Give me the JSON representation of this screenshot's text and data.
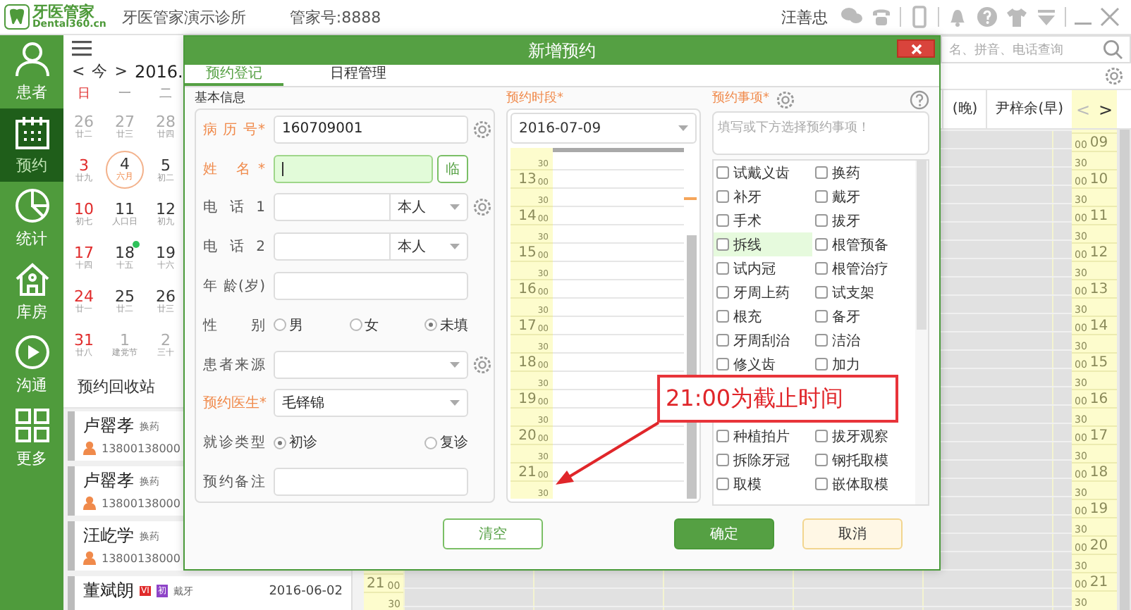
{
  "header": {
    "logo_title": "牙医管家",
    "logo_subtitle": "Dental360.cn",
    "clinic": "牙医管家演示诊所",
    "account": "管家号:8888",
    "user": "汪善忠"
  },
  "sidebar": {
    "items": [
      {
        "label": "患者",
        "selected": false
      },
      {
        "label": "预约",
        "selected": true
      },
      {
        "label": "统计",
        "selected": false
      },
      {
        "label": "库房",
        "selected": false
      },
      {
        "label": "沟通",
        "selected": false
      },
      {
        "label": "更多",
        "selected": false
      }
    ]
  },
  "calendar_panel": {
    "nav": {
      "prev": "<",
      "today": "今",
      "next": ">",
      "month": "2016."
    },
    "weekdays": [
      "日",
      "一",
      "二"
    ],
    "weeks": [
      [
        {
          "day": "26",
          "lunar": "廿二",
          "muted": true,
          "today": false,
          "has_event": false
        },
        {
          "day": "27",
          "lunar": "廿三",
          "muted": true,
          "today": false,
          "has_event": false
        },
        {
          "day": "28",
          "lunar": "廿四",
          "muted": true,
          "today": false,
          "has_event": false
        }
      ],
      [
        {
          "day": "3",
          "lunar": "廿九",
          "muted": false,
          "today": false,
          "has_event": false
        },
        {
          "day": "4",
          "lunar": "六月",
          "muted": false,
          "today": true,
          "has_event": false
        },
        {
          "day": "5",
          "lunar": "初二",
          "muted": false,
          "today": false,
          "has_event": false
        }
      ],
      [
        {
          "day": "10",
          "lunar": "初七",
          "muted": false,
          "today": false,
          "has_event": false
        },
        {
          "day": "11",
          "lunar": "人口日",
          "muted": false,
          "today": false,
          "has_event": false
        },
        {
          "day": "12",
          "lunar": "初九",
          "muted": false,
          "today": false,
          "has_event": false
        }
      ],
      [
        {
          "day": "17",
          "lunar": "十四",
          "muted": false,
          "today": false,
          "has_event": false
        },
        {
          "day": "18",
          "lunar": "十五",
          "muted": false,
          "today": false,
          "has_event": true
        },
        {
          "day": "19",
          "lunar": "十六",
          "muted": false,
          "today": false,
          "has_event": false
        }
      ],
      [
        {
          "day": "24",
          "lunar": "廿一",
          "muted": false,
          "today": false,
          "has_event": false
        },
        {
          "day": "25",
          "lunar": "廿二",
          "muted": false,
          "today": false,
          "has_event": false
        },
        {
          "day": "26",
          "lunar": "廿三",
          "muted": false,
          "today": false,
          "has_event": false
        }
      ],
      [
        {
          "day": "31",
          "lunar": "廿八",
          "muted": false,
          "today": false,
          "has_event": false
        },
        {
          "day": "1",
          "lunar": "建党节",
          "muted": true,
          "today": false,
          "has_event": false
        },
        {
          "day": "2",
          "lunar": "三十",
          "muted": true,
          "today": false,
          "has_event": false
        }
      ]
    ],
    "recycle_title": "预约回收站",
    "appointments": [
      {
        "name": "卢罂孝",
        "tag": "换药",
        "phone": "13800138000"
      },
      {
        "name": "卢罂孝",
        "tag": "换药",
        "phone": "13800138000"
      },
      {
        "name": "汪屹学",
        "tag": "换药",
        "phone": "13800138000"
      },
      {
        "name": "董斌朗",
        "badges": [
          {
            "text": "VI",
            "color": "#e02b2b"
          },
          {
            "text": "初",
            "color": "#8e44c8"
          }
        ],
        "tag": "戴牙",
        "date": "2016-06-02"
      }
    ]
  },
  "schedule": {
    "search": {
      "placeholder": "名、拼音、电话查询"
    },
    "columns": [
      "(晚)",
      "尹梓余(早)"
    ],
    "nav": {
      "prev": "<",
      "next": ">"
    },
    "left_times": [
      {
        "hour": "21",
        "minute": "00",
        "half": "30"
      }
    ],
    "right_times": [
      {
        "hour": "09",
        "minute": "00",
        "half": "30"
      },
      {
        "hour": "10",
        "minute": "00",
        "half": "30"
      },
      {
        "hour": "11",
        "minute": "00",
        "half": "30"
      },
      {
        "hour": "12",
        "minute": "00",
        "half": "30"
      },
      {
        "hour": "13",
        "minute": "00",
        "half": "30"
      },
      {
        "hour": "14",
        "minute": "00",
        "half": "30"
      },
      {
        "hour": "15",
        "minute": "00",
        "half": "30"
      },
      {
        "hour": "16",
        "minute": "00",
        "half": "30"
      },
      {
        "hour": "17",
        "minute": "00",
        "half": "30"
      },
      {
        "hour": "18",
        "minute": "00",
        "half": "30"
      },
      {
        "hour": "19",
        "minute": "00",
        "half": "30"
      },
      {
        "hour": "20",
        "minute": "00",
        "half": "30"
      },
      {
        "hour": "21",
        "minute": "00",
        "half": "30"
      }
    ]
  },
  "dialog": {
    "title": "新增预约",
    "tabs": [
      {
        "label": "预约登记",
        "selected": true
      },
      {
        "label": "日程管理",
        "selected": false
      }
    ],
    "basic_info": {
      "legend": "基本信息",
      "fields": [
        {
          "label": "病 历 号*",
          "required": true,
          "kind": "text",
          "value": "160709001",
          "gear": true
        },
        {
          "label": "姓 名*",
          "required": true,
          "kind": "name",
          "button": "临",
          "focused": true
        },
        {
          "label": "电 话 1",
          "required": false,
          "kind": "phone",
          "relation": "本人",
          "gear": true
        },
        {
          "label": "电 话 2",
          "required": false,
          "kind": "phone",
          "relation": "本人",
          "gear": false
        },
        {
          "label": "年 龄(岁)",
          "required": false,
          "kind": "text"
        },
        {
          "label": "性 别",
          "required": false,
          "kind": "radio",
          "options": [
            {
              "label": "男",
              "selected": false
            },
            {
              "label": "女",
              "selected": false
            },
            {
              "label": "未填",
              "selected": true
            }
          ]
        },
        {
          "label": "患者来源",
          "required": false,
          "kind": "select",
          "gear": true
        },
        {
          "label": "预约医生*",
          "required": true,
          "kind": "select",
          "value": "毛铎锦"
        },
        {
          "label": "就诊类型",
          "required": false,
          "kind": "radio",
          "options": [
            {
              "label": "初诊",
              "selected": true
            },
            {
              "label": "复诊",
              "selected": false
            }
          ]
        },
        {
          "label": "预约备注",
          "required": false,
          "kind": "text"
        }
      ]
    },
    "time_slot": {
      "label": "预约时段*",
      "date": "2016-07-09",
      "rows": [
        {
          "minute": "30"
        },
        {
          "hour": "13",
          "minute": "00"
        },
        {
          "minute": "30"
        },
        {
          "hour": "14",
          "minute": "00"
        },
        {
          "minute": "30"
        },
        {
          "hour": "15",
          "minute": "00"
        },
        {
          "minute": "30"
        },
        {
          "hour": "16",
          "minute": "00"
        },
        {
          "minute": "30"
        },
        {
          "hour": "17",
          "minute": "00"
        },
        {
          "minute": "30"
        },
        {
          "hour": "18",
          "minute": "00"
        },
        {
          "minute": "30"
        },
        {
          "hour": "19",
          "minute": "00"
        },
        {
          "minute": "30"
        },
        {
          "hour": "20",
          "minute": "00"
        },
        {
          "minute": "30"
        },
        {
          "hour": "21",
          "minute": "00"
        },
        {
          "minute": "30"
        }
      ]
    },
    "items": {
      "label": "预约事项*",
      "placeholder": "填写或下方选择预约事项！",
      "options": [
        {
          "label": "试戴义齿",
          "checked": false,
          "hovered": false
        },
        {
          "label": "换药",
          "checked": false,
          "hovered": false
        },
        {
          "label": "补牙",
          "checked": false,
          "hovered": false
        },
        {
          "label": "戴牙",
          "checked": false,
          "hovered": false
        },
        {
          "label": "手术",
          "checked": false,
          "hovered": false
        },
        {
          "label": "拔牙",
          "checked": false,
          "hovered": false
        },
        {
          "label": "拆线",
          "checked": false,
          "hovered": true
        },
        {
          "label": "根管预备",
          "checked": false,
          "hovered": false
        },
        {
          "label": "试内冠",
          "checked": false,
          "hovered": false
        },
        {
          "label": "根管治疗",
          "checked": false,
          "hovered": false
        },
        {
          "label": "牙周上药",
          "checked": false,
          "hovered": false
        },
        {
          "label": "试支架",
          "checked": false,
          "hovered": false
        },
        {
          "label": "根充",
          "checked": false,
          "hovered": false
        },
        {
          "label": "备牙",
          "checked": false,
          "hovered": false
        },
        {
          "label": "牙周刮治",
          "checked": false,
          "hovered": false
        },
        {
          "label": "洁治",
          "checked": false,
          "hovered": false
        },
        {
          "label": "修义齿",
          "checked": false,
          "hovered": false
        },
        {
          "label": "加力",
          "checked": false,
          "hovered": false
        }
      ],
      "lower_options": [
        {
          "label": "种植拍片",
          "checked": false,
          "hovered": false
        },
        {
          "label": "拔牙观察",
          "checked": false,
          "hovered": false
        },
        {
          "label": "拆除牙冠",
          "checked": false,
          "hovered": false
        },
        {
          "label": "钢托取模",
          "checked": false,
          "hovered": false
        },
        {
          "label": "取模",
          "checked": false,
          "hovered": false
        },
        {
          "label": "嵌体取模",
          "checked": false,
          "hovered": false
        }
      ]
    },
    "buttons": [
      {
        "label": "清空",
        "kind": "outline"
      },
      {
        "label": "确定",
        "kind": "primary"
      },
      {
        "label": "取消",
        "kind": "cancel"
      }
    ]
  },
  "annotation": {
    "text": "21:00为截止时间"
  }
}
